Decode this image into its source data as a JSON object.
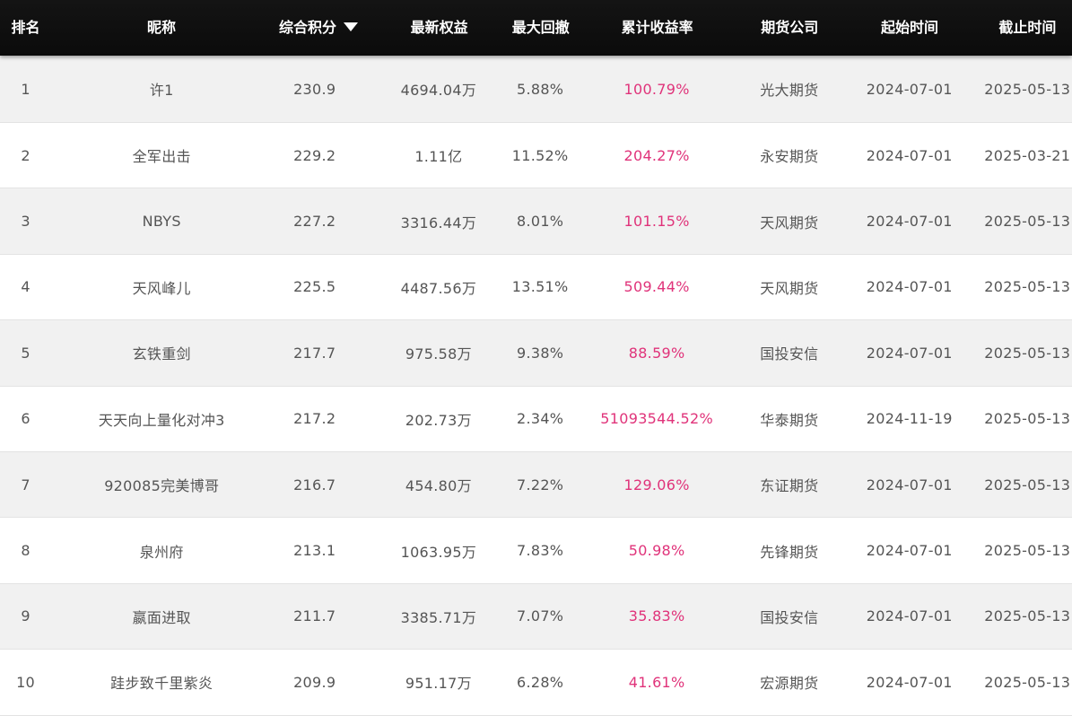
{
  "headers": {
    "rank": "排名",
    "nickname": "昵称",
    "score": "综合积分",
    "equity": "最新权益",
    "drawdown": "最大回撤",
    "return": "累计收益率",
    "company": "期货公司",
    "start": "起始时间",
    "end": "截止时间"
  },
  "sort": {
    "column": "综合积分",
    "direction": "descending",
    "icon": "sort-down-triangle-icon"
  },
  "colors": {
    "header_bg": "#111111",
    "header_text": "#ffffff",
    "row_odd_bg": "#f1f1f1",
    "row_even_bg": "#ffffff",
    "text": "#555555",
    "return_text": "#e0337a"
  },
  "rows": [
    {
      "rank": "1",
      "nickname": "许1",
      "score": "230.9",
      "equity": "4694.04万",
      "drawdown": "5.88%",
      "return": "100.79%",
      "company": "光大期货",
      "start": "2024-07-01",
      "end": "2025-05-13"
    },
    {
      "rank": "2",
      "nickname": "全军出击",
      "score": "229.2",
      "equity": "1.11亿",
      "drawdown": "11.52%",
      "return": "204.27%",
      "company": "永安期货",
      "start": "2024-07-01",
      "end": "2025-03-21"
    },
    {
      "rank": "3",
      "nickname": "NBYS",
      "score": "227.2",
      "equity": "3316.44万",
      "drawdown": "8.01%",
      "return": "101.15%",
      "company": "天风期货",
      "start": "2024-07-01",
      "end": "2025-05-13"
    },
    {
      "rank": "4",
      "nickname": "天风峰儿",
      "score": "225.5",
      "equity": "4487.56万",
      "drawdown": "13.51%",
      "return": "509.44%",
      "company": "天风期货",
      "start": "2024-07-01",
      "end": "2025-05-13"
    },
    {
      "rank": "5",
      "nickname": "玄铁重剑",
      "score": "217.7",
      "equity": "975.58万",
      "drawdown": "9.38%",
      "return": "88.59%",
      "company": "国投安信",
      "start": "2024-07-01",
      "end": "2025-05-13"
    },
    {
      "rank": "6",
      "nickname": "天天向上量化对冲3",
      "score": "217.2",
      "equity": "202.73万",
      "drawdown": "2.34%",
      "return": "51093544.52%",
      "company": "华泰期货",
      "start": "2024-11-19",
      "end": "2025-05-13"
    },
    {
      "rank": "7",
      "nickname": "920085完美博哥",
      "score": "216.7",
      "equity": "454.80万",
      "drawdown": "7.22%",
      "return": "129.06%",
      "company": "东证期货",
      "start": "2024-07-01",
      "end": "2025-05-13"
    },
    {
      "rank": "8",
      "nickname": "泉州府",
      "score": "213.1",
      "equity": "1063.95万",
      "drawdown": "7.83%",
      "return": "50.98%",
      "company": "先锋期货",
      "start": "2024-07-01",
      "end": "2025-05-13"
    },
    {
      "rank": "9",
      "nickname": "嬴面进取",
      "score": "211.7",
      "equity": "3385.71万",
      "drawdown": "7.07%",
      "return": "35.83%",
      "company": "国投安信",
      "start": "2024-07-01",
      "end": "2025-05-13"
    },
    {
      "rank": "10",
      "nickname": "跬步致千里紫炎",
      "score": "209.9",
      "equity": "951.17万",
      "drawdown": "6.28%",
      "return": "41.61%",
      "company": "宏源期货",
      "start": "2024-07-01",
      "end": "2025-05-13"
    }
  ]
}
